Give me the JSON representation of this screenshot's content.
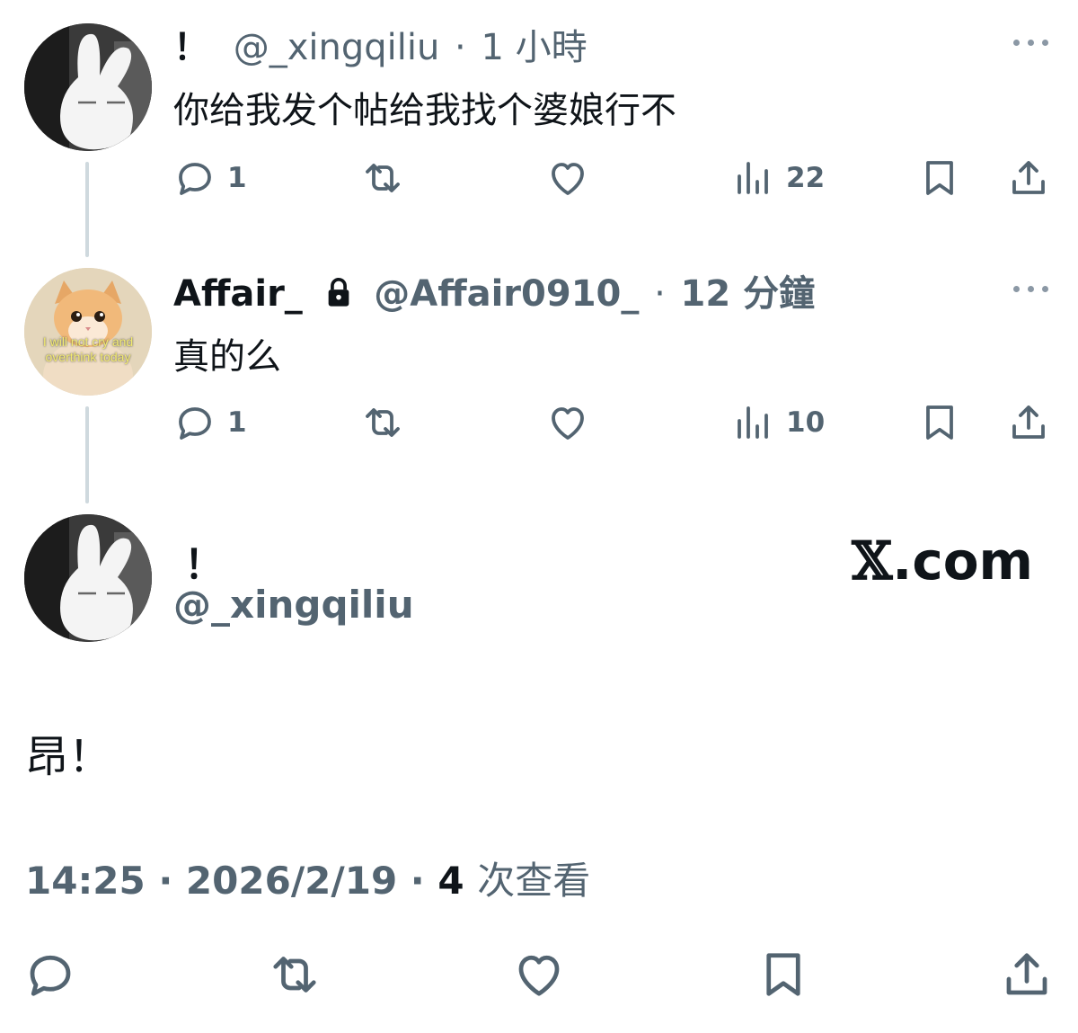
{
  "thread": [
    {
      "name": "！",
      "handle": "@_xingqiliu",
      "separator": "·",
      "time": "1 小時",
      "text": "你给我发个帖给我找个婆娘行不",
      "replies": "1",
      "views": "22"
    },
    {
      "name": "Affair_",
      "handle": "@Affair0910_",
      "separator": "·",
      "time": "12 分鐘",
      "text": "真的么",
      "replies": "1",
      "views": "10",
      "avatar_caption": "I will not cry and overthink today"
    }
  ],
  "focal": {
    "name": "！",
    "handle": "@_xingqiliu",
    "brand_mark": "𝕏",
    "brand_suffix": ".com",
    "text": "昂！",
    "time": "14:25",
    "separator": "·",
    "date": "2026/2/19",
    "views": "4",
    "views_label": "次查看"
  },
  "icons": {
    "reply": "reply-icon",
    "repost": "repost-icon",
    "like": "like-icon",
    "views": "views-icon",
    "bookmark": "bookmark-icon",
    "share": "share-icon",
    "more": "more-icon",
    "lock": "lock-icon"
  },
  "colors": {
    "text_primary": "#0f1419",
    "text_secondary": "#536471",
    "thread_line": "#cfd9de",
    "icon": "#536471"
  }
}
